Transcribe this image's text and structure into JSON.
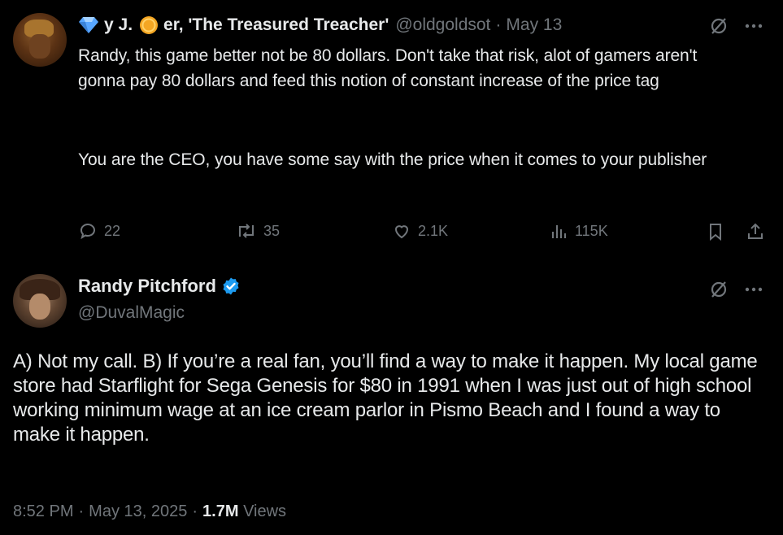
{
  "reply_tweet": {
    "display_name_parts": [
      "y J.",
      "er, 'The Treasured Treacher'"
    ],
    "handle": "@oldgoldsot",
    "separator": "·",
    "date": "May 13",
    "text_paragraph_1": "Randy, this game better not be 80 dollars. Don't take that risk, alot of gamers aren't gonna pay 80 dollars and feed this notion of constant increase of the price tag",
    "text_paragraph_2": "You are the CEO, you have some say with the price when it comes to your publisher",
    "actions": {
      "replies": "22",
      "retweets": "35",
      "likes": "2.1K",
      "views": "115K"
    }
  },
  "main_tweet": {
    "display_name": "Randy Pitchford",
    "handle": "@DuvalMagic",
    "text": "A) Not my call. B) If you’re a real fan, you’ll find a way to make it happen. My local game store had Starflight for Sega Genesis for $80 in 1991 when I was just out of high school working minimum wage at an ice cream parlor in Pismo Beach and I found a way to make it happen.",
    "time": "8:52 PM",
    "date": "May 13, 2025",
    "separator": "·",
    "views_count": "1.7M",
    "views_label": "Views"
  },
  "colors": {
    "background": "#000000",
    "text": "#e7e9ea",
    "muted": "#71767b",
    "verified_blue": "#1d9bf0",
    "gem_blue": "#58a6ff",
    "coin_gold": "#f4a623"
  },
  "icons": [
    "gem-emoji-icon",
    "coin-emoji-icon",
    "grok-icon",
    "more-icon",
    "reply-icon",
    "retweet-icon",
    "like-icon",
    "views-icon",
    "bookmark-icon",
    "share-icon",
    "verified-badge-icon"
  ]
}
